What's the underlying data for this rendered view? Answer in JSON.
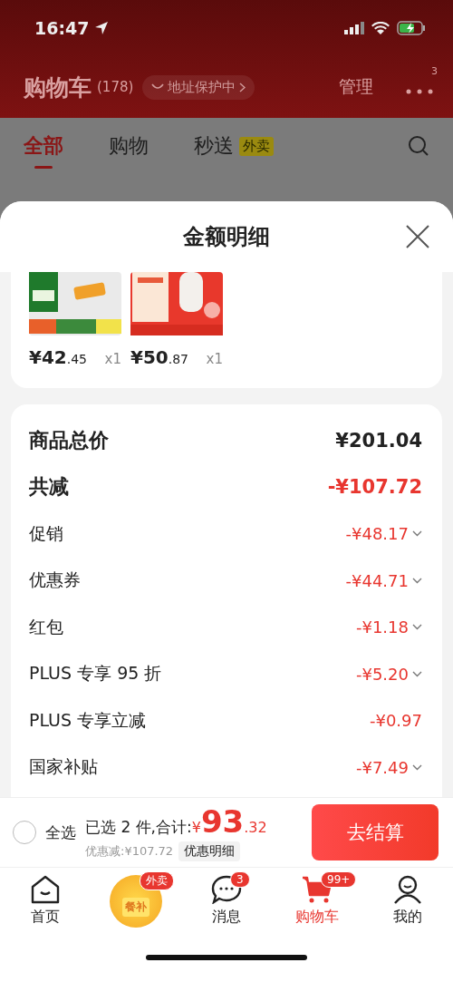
{
  "status_bar": {
    "time": "16:47"
  },
  "header": {
    "title": "购物车",
    "count": "(178)",
    "address_pill": "地址保护中",
    "manage": "管理",
    "more_badge": "3"
  },
  "tabs": [
    {
      "label": "全部",
      "selected": true
    },
    {
      "label": "购物",
      "selected": false
    },
    {
      "label": "秒送",
      "selected": false,
      "tag": "外卖"
    }
  ],
  "sheet": {
    "title": "金额明细",
    "products": [
      {
        "kind": "picture",
        "price": "¥42.45",
        "quantity": "x1"
      },
      {
        "kind": "picture",
        "price": "¥50.87",
        "quantity": "x1"
      }
    ],
    "details": [
      {
        "kind": "total",
        "label": "商品总价",
        "value": "¥201.04",
        "expandable": false
      },
      {
        "kind": "discount_total",
        "label": "共减",
        "value": "-¥107.72",
        "expandable": false
      },
      {
        "kind": "item",
        "label": "促销",
        "value": "-¥48.17",
        "expandable": true
      },
      {
        "kind": "item",
        "label": "优惠券",
        "value": "-¥44.71",
        "expandable": true
      },
      {
        "kind": "item",
        "label": "红包",
        "value": "-¥1.18",
        "expandable": true
      },
      {
        "kind": "item",
        "label": "PLUS 专享 95 折",
        "value": "-¥5.20",
        "expandable": true
      },
      {
        "kind": "item",
        "label": "PLUS 专享立减",
        "value": "-¥0.97",
        "expandable": false
      },
      {
        "kind": "item",
        "label": "国家补贴",
        "value": "-¥7.49",
        "expandable": true
      }
    ]
  },
  "checkout": {
    "select_all": {
      "label": "全选",
      "checked": false
    },
    "summary": "已选 2 件,合计:",
    "total": "¥93.32",
    "saved": "优惠减:¥107.72",
    "detail_button": "优惠明细",
    "button": "去结算"
  },
  "tab_bar": [
    {
      "kind": "home",
      "label": "首页",
      "selected": false
    },
    {
      "kind": "promo",
      "icon_text": "餐补",
      "badge": "外卖"
    },
    {
      "kind": "messages",
      "label": "消息",
      "badge": "3",
      "selected": false
    },
    {
      "kind": "cart",
      "label": "购物车",
      "badge": "99+",
      "selected": true
    },
    {
      "kind": "profile",
      "label": "我的",
      "selected": false
    }
  ]
}
